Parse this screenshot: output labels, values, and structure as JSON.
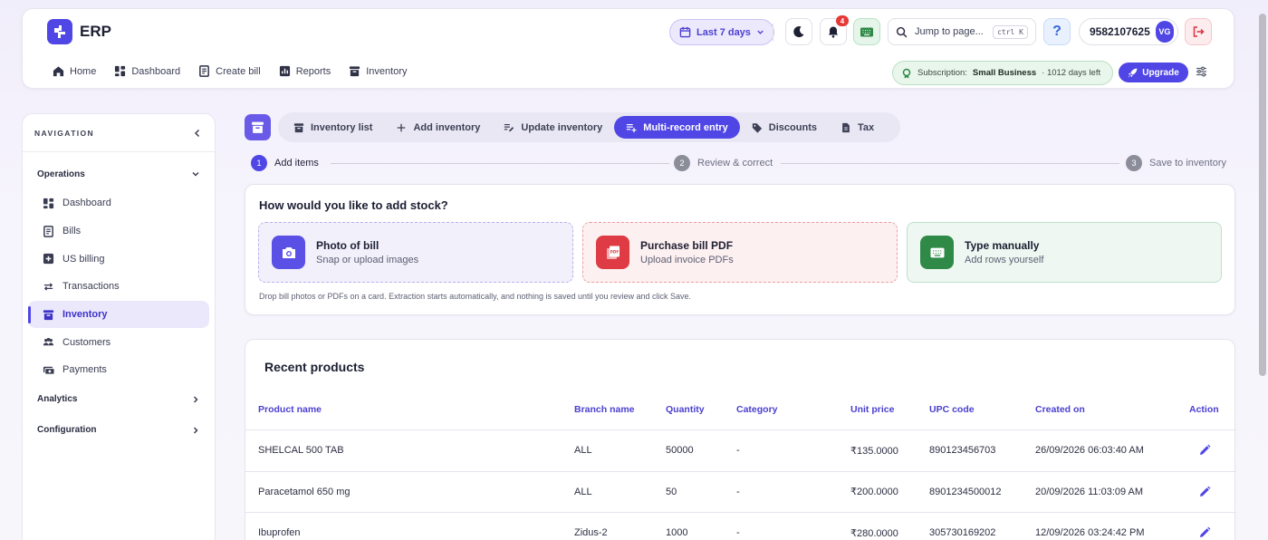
{
  "app": {
    "name": "ERP",
    "brand_color": "#4f46e5"
  },
  "header": {
    "nav": [
      {
        "label": "Home",
        "icon": "home-icon"
      },
      {
        "label": "Dashboard",
        "icon": "dashboard-icon"
      },
      {
        "label": "Create bill",
        "icon": "bill-icon"
      },
      {
        "label": "Reports",
        "icon": "reports-icon"
      },
      {
        "label": "Inventory",
        "icon": "inventory-icon"
      }
    ],
    "date_range": "Last 7 days",
    "notifications_count": "4",
    "jump_placeholder": "Jump to page...",
    "jump_shortcut": "ctrl K",
    "help_label": "?",
    "phone": "9582107625",
    "avatar_initials": "VG",
    "subscription_label": "Subscription:",
    "subscription_plan": "Small Business",
    "subscription_days": "· 1012 days left",
    "upgrade_label": "Upgrade"
  },
  "sidebar": {
    "title": "NAVIGATION",
    "sections": {
      "operations": "Operations",
      "analytics": "Analytics",
      "configuration": "Configuration"
    },
    "items": [
      {
        "label": "Dashboard",
        "icon": "dashboard-icon"
      },
      {
        "label": "Bills",
        "icon": "bill-icon"
      },
      {
        "label": "US billing",
        "icon": "plus-box-icon"
      },
      {
        "label": "Transactions",
        "icon": "transfer-icon"
      },
      {
        "label": "Inventory",
        "icon": "inventory-icon",
        "active": true
      },
      {
        "label": "Customers",
        "icon": "customers-icon"
      },
      {
        "label": "Payments",
        "icon": "payments-icon"
      }
    ]
  },
  "tabs": [
    {
      "label": "Inventory list",
      "icon": "inventory-icon"
    },
    {
      "label": "Add inventory",
      "icon": "plus-icon"
    },
    {
      "label": "Update inventory",
      "icon": "edit-list-icon"
    },
    {
      "label": "Multi-record entry",
      "icon": "playlist-add-icon",
      "active": true
    },
    {
      "label": "Discounts",
      "icon": "tag-icon"
    },
    {
      "label": "Tax",
      "icon": "document-icon"
    }
  ],
  "stepper": [
    {
      "num": "1",
      "label": "Add items",
      "current": true
    },
    {
      "num": "2",
      "label": "Review & correct"
    },
    {
      "num": "3",
      "label": "Save to inventory"
    }
  ],
  "stock": {
    "title": "How would you like to add stock?",
    "options": [
      {
        "title": "Photo of bill",
        "subtitle": "Snap or upload images",
        "icon": "camera-icon"
      },
      {
        "title": "Purchase bill PDF",
        "subtitle": "Upload invoice PDFs",
        "icon": "pdf-icon"
      },
      {
        "title": "Type manually",
        "subtitle": "Add rows yourself",
        "icon": "keyboard-icon"
      }
    ],
    "hint": "Drop bill photos or PDFs on a card. Extraction starts automatically, and nothing is saved until you review and click Save."
  },
  "products": {
    "title": "Recent products",
    "columns": [
      "Product name",
      "Branch name",
      "Quantity",
      "Category",
      "Unit price",
      "UPC code",
      "Created on",
      "Action"
    ],
    "rows": [
      [
        "SHELCAL 500 TAB",
        "ALL",
        "50000",
        "-",
        "₹135.0000",
        "890123456703",
        "26/09/2026 06:03:40 AM"
      ],
      [
        "Paracetamol 650 mg",
        "ALL",
        "50",
        "-",
        "₹200.0000",
        "8901234500012",
        "20/09/2026 11:03:09 AM"
      ],
      [
        "Ibuprofen",
        "Zidus-2",
        "1000",
        "-",
        "₹280.0000",
        "305730169202",
        "12/09/2026 03:24:42 PM"
      ]
    ]
  }
}
